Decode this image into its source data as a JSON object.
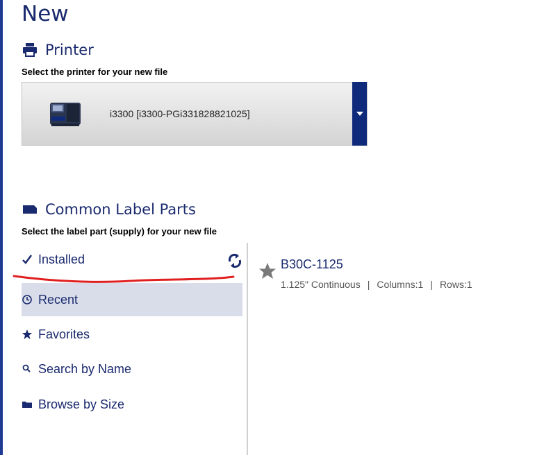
{
  "page": {
    "title": "New"
  },
  "printer": {
    "section_title": "Printer",
    "instruction": "Select the printer for your new file",
    "selected": "i3300 [i3300-PGi331828821025]"
  },
  "parts": {
    "section_title": "Common Label Parts",
    "instruction": "Select the label part (supply) for your new file",
    "nav": [
      {
        "label": "Installed",
        "icon": "checkmark-icon"
      },
      {
        "label": "Recent",
        "icon": "clock-icon"
      },
      {
        "label": "Favorites",
        "icon": "star-icon"
      },
      {
        "label": "Search by Name",
        "icon": "search-icon"
      },
      {
        "label": "Browse by Size",
        "icon": "folder-icon"
      }
    ],
    "selected_nav": "Recent",
    "items": [
      {
        "name": "B30C-1125",
        "size": "1.125\" Continuous",
        "columns": "Columns:1",
        "rows": "Rows:1"
      }
    ]
  },
  "colors": {
    "accent": "#0f2a7a",
    "text": "#1a2a6e",
    "annotation": "#e02020",
    "selected_bg": "#d8dde9"
  }
}
